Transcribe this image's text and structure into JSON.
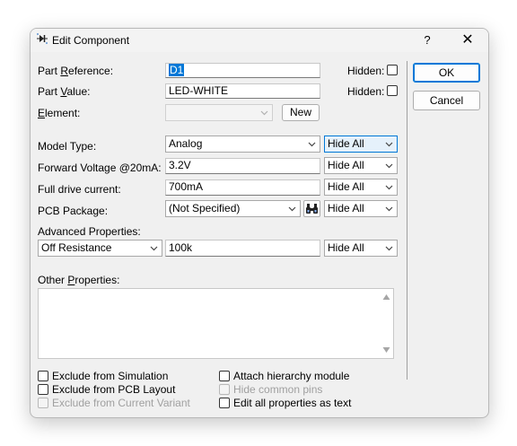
{
  "window": {
    "title": "Edit Component",
    "help_label": "?",
    "close_label": "✕"
  },
  "fields": {
    "part_reference": {
      "label_pre": "Part ",
      "label_ul": "R",
      "label_post": "eference:",
      "value": "D1"
    },
    "part_value": {
      "label_pre": "Part ",
      "label_ul": "V",
      "label_post": "alue:",
      "value": "LED-WHITE"
    },
    "element": {
      "label_pre": "",
      "label_ul": "E",
      "label_post": "lement:",
      "value": "",
      "new_label": "New"
    },
    "hidden_label": "Hidden:"
  },
  "properties": {
    "model_type": {
      "label": "Model Type:",
      "value": "Analog",
      "hide": "Hide All"
    },
    "forward_voltage": {
      "label": "Forward Voltage @20mA:",
      "value": "3.2V",
      "hide": "Hide All"
    },
    "full_drive_current": {
      "label": "Full drive current:",
      "value": "700mA",
      "hide": "Hide All"
    },
    "pcb_package": {
      "label": "PCB Package:",
      "value": "(Not Specified)",
      "hide": "Hide All"
    },
    "advanced_label": "Advanced Properties:",
    "advanced": {
      "name": "Off Resistance",
      "value": "100k",
      "hide": "Hide All"
    }
  },
  "other_properties": {
    "label_pre": "Other ",
    "label_ul": "P",
    "label_post": "roperties:",
    "text": ""
  },
  "options": {
    "exclude_simulation": "Exclude from Simulation",
    "exclude_pcb": "Exclude from PCB Layout",
    "exclude_variant": "Exclude from Current Variant",
    "attach_hierarchy": "Attach hierarchy module",
    "hide_common_pins": "Hide common pins",
    "edit_all_text": "Edit all properties as text"
  },
  "buttons": {
    "ok": "OK",
    "cancel": "Cancel"
  },
  "colors": {
    "accent": "#0078d7",
    "dialog_bg": "#f0f0f0"
  }
}
